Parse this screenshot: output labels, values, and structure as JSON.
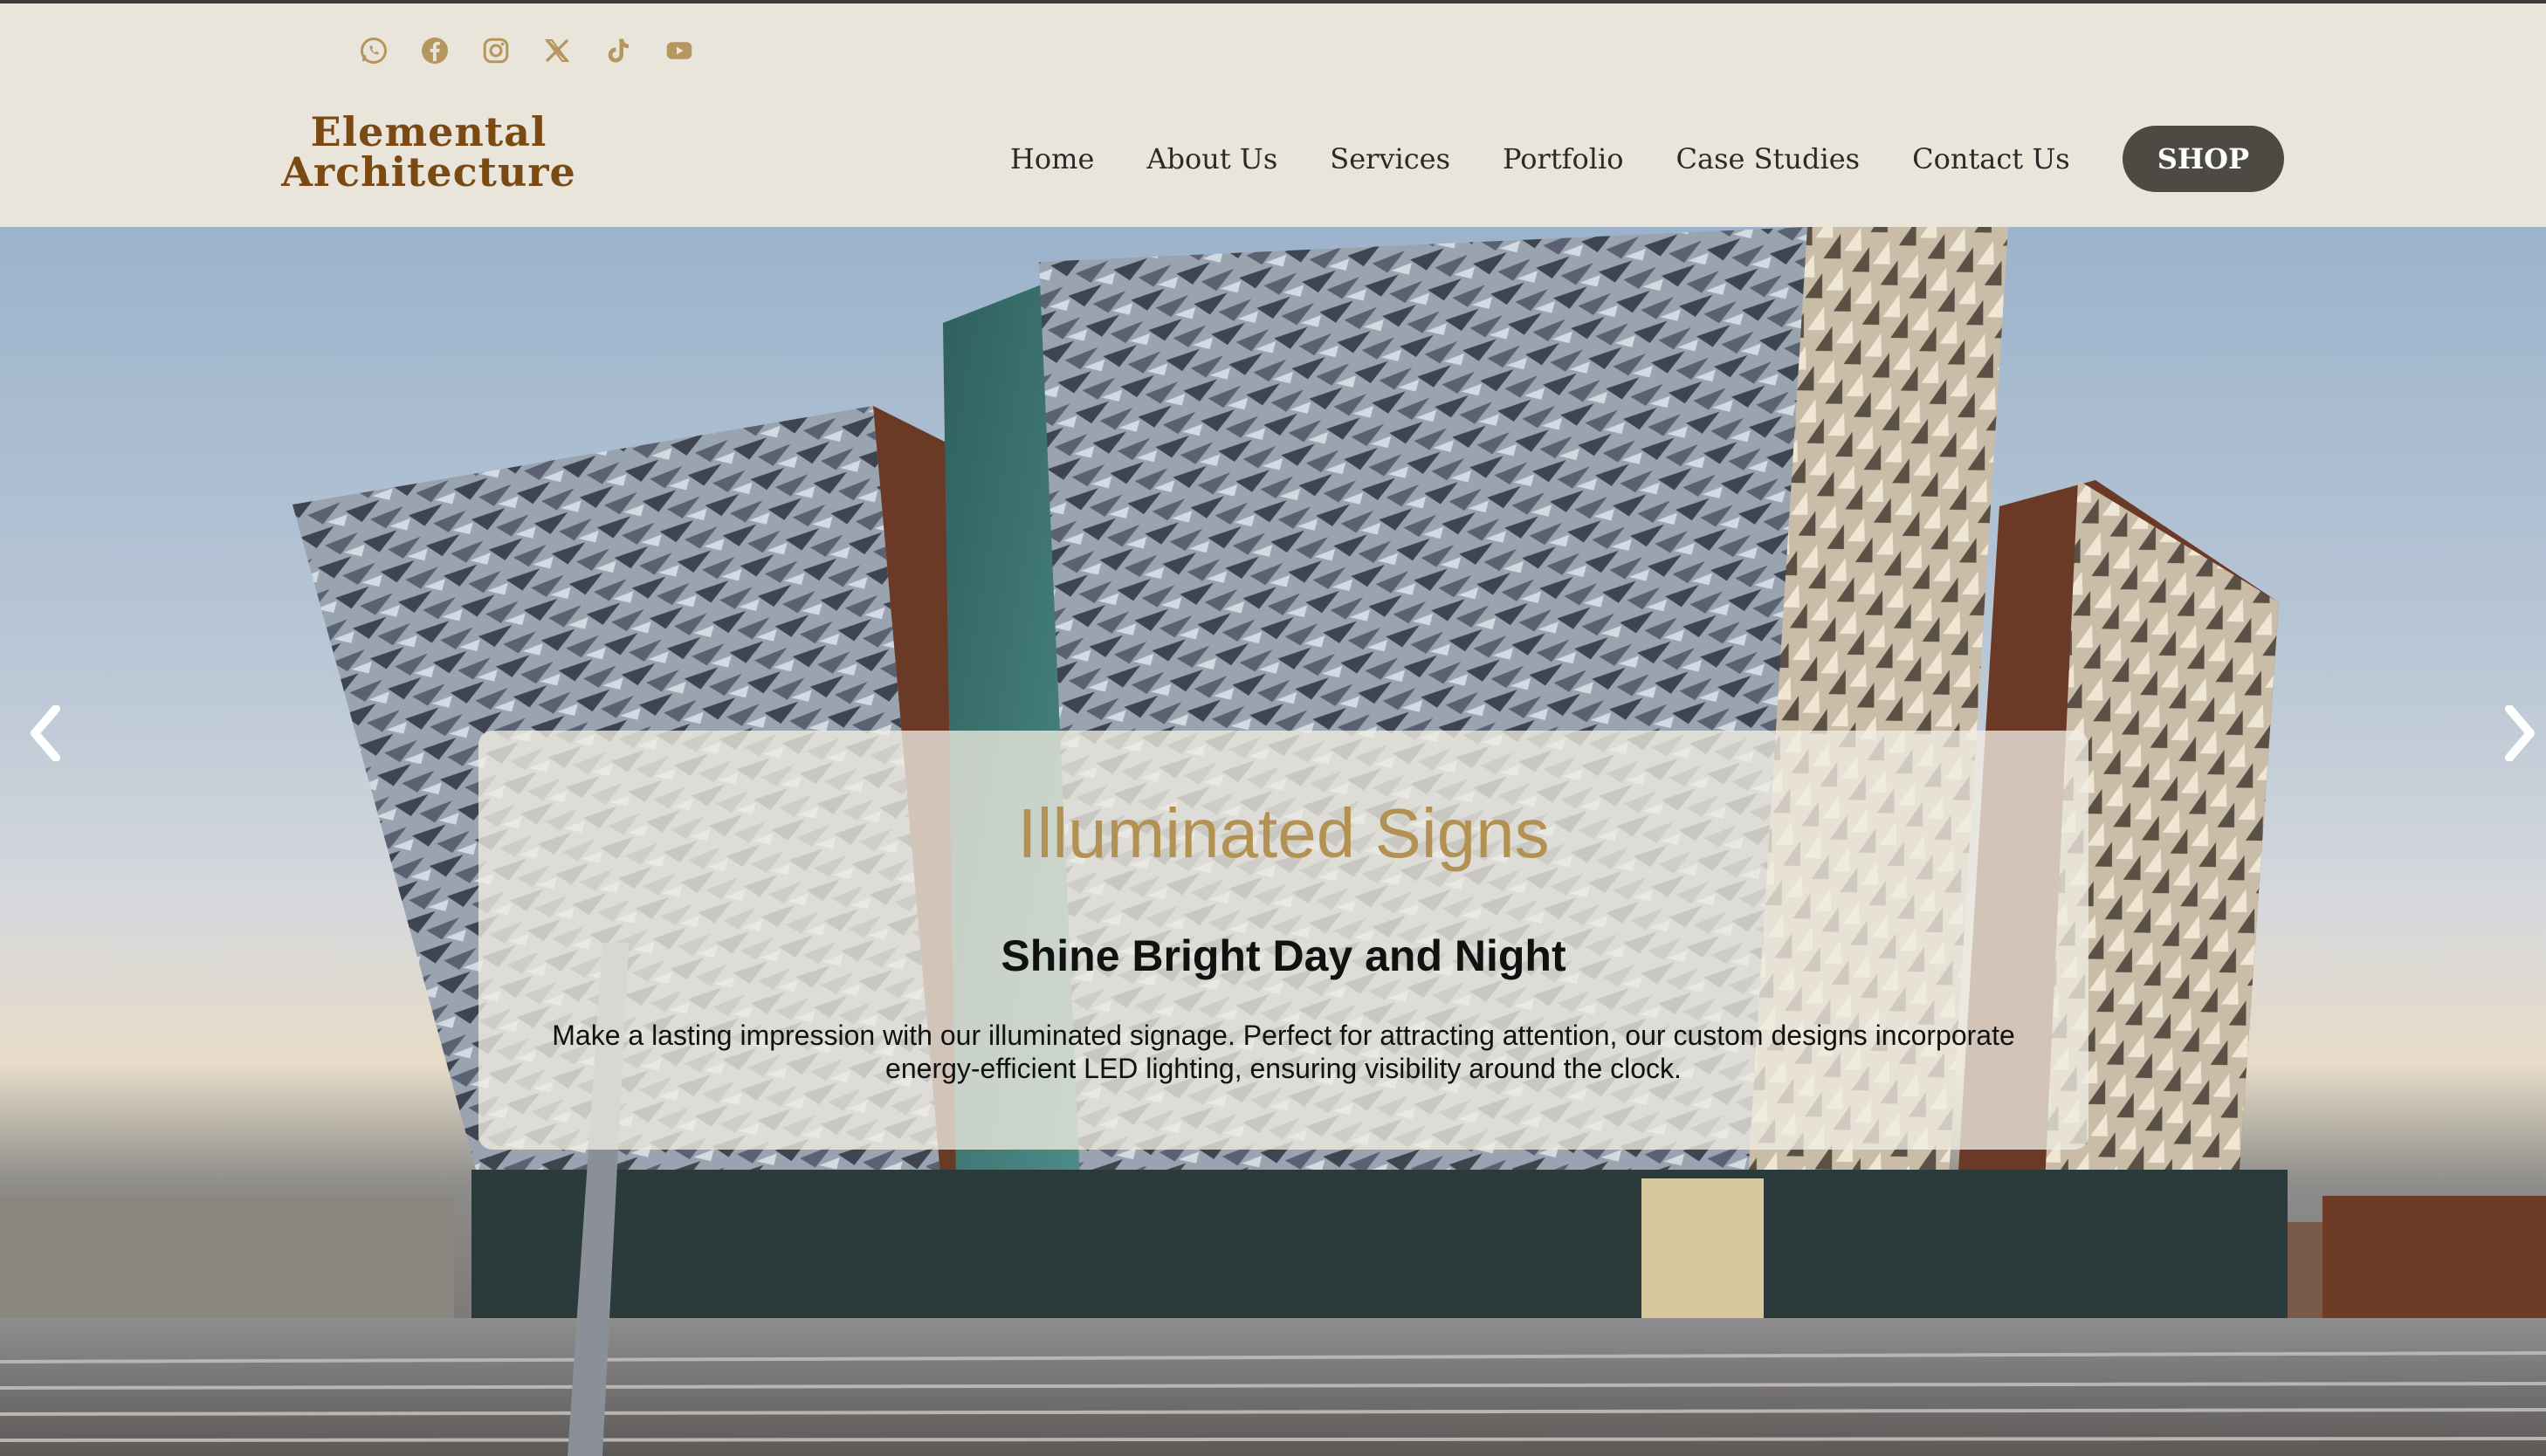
{
  "social": {
    "icons": [
      "whatsapp-icon",
      "facebook-icon",
      "instagram-icon",
      "x-icon",
      "tiktok-icon",
      "youtube-icon"
    ],
    "icon_color": "#b5965d"
  },
  "logo": {
    "line1": "Elemental",
    "line2": "Architecture",
    "color": "#7b4a12"
  },
  "nav": {
    "items": [
      "Home",
      "About Us",
      "Services",
      "Portfolio",
      "Case Studies",
      "Contact Us"
    ],
    "shop_label": "SHOP",
    "shop_bg": "#4d4a44"
  },
  "hero": {
    "title": "Illuminated Signs",
    "subtitle": "Shine Bright Day and Night",
    "body": "Make a lasting impression with our illuminated signage. Perfect for attracting attention, our custom designs incorporate energy-efficient LED lighting, ensuring visibility around the clock.",
    "title_color": "#b29152",
    "prev_icon": "chevron-left-icon",
    "next_icon": "chevron-right-icon"
  }
}
